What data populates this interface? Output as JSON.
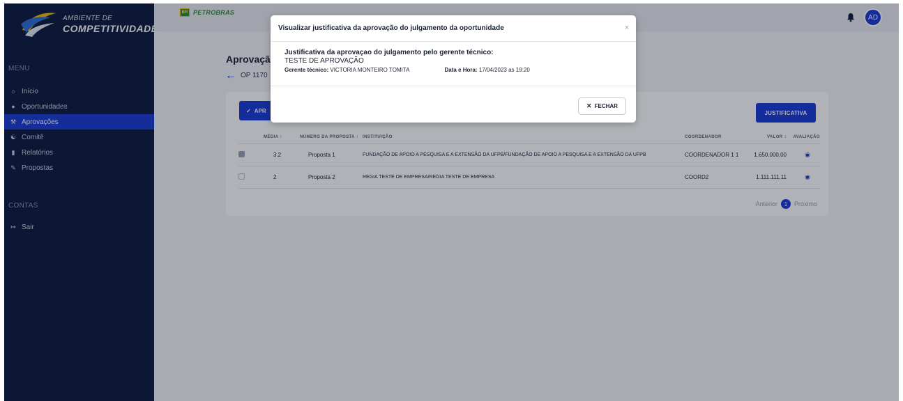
{
  "sidebar": {
    "logo_line1": "AMBIENTE DE",
    "logo_line2": "COMPETITIVIDADE",
    "menu_title": "MENU",
    "items": [
      {
        "label": "Início",
        "icon": "home-icon"
      },
      {
        "label": "Oportunidades",
        "icon": "lightbulb-icon"
      },
      {
        "label": "Aprovações",
        "icon": "gavel-icon",
        "active": true
      },
      {
        "label": "Comitê",
        "icon": "group-icon"
      },
      {
        "label": "Relatórios",
        "icon": "report-icon"
      },
      {
        "label": "Propostas",
        "icon": "proposal-icon"
      }
    ],
    "contas_title": "CONTAS",
    "sair_label": "Sair"
  },
  "topbar": {
    "brand_box": "BR",
    "brand": "PETROBRAS",
    "avatar_initials": "AD"
  },
  "main": {
    "title": "Aprovaçã",
    "op_code": "OP 1170",
    "aprovar_label": "APR",
    "justificativa_label": "JUSTIFICATIVA",
    "table": {
      "headers": [
        "MÉDIA",
        "NÚMERO DA PROPOSTA",
        "INSTITUIÇÃO",
        "COORDENADOR",
        "VALOR",
        "AVALIAÇÃO"
      ],
      "rows": [
        {
          "checked": true,
          "media": "3.2",
          "numero": "Proposta 1",
          "instituicao": "FUNDAÇÃO DE APOIO A PESQUISA E A EXTENSÃO DA UFPB/FUNDAÇÃO DE APOIO A PESQUISA E A EXTENSÃO DA UFPB",
          "coordenador": "COORDENADOR 1 1",
          "valor": "1.650.000,00"
        },
        {
          "checked": false,
          "media": "2",
          "numero": "Proposta 2",
          "instituicao": "REGIA TESTE DE EMPRESA/REGIA TESTE DE EMPRESA",
          "coordenador": "COORD2",
          "valor": "1.111.111,11"
        }
      ]
    },
    "pager": {
      "prev": "Anterior",
      "page": "1",
      "next": "Próximo"
    }
  },
  "modal": {
    "title": "Visualizar justificativa da aprovação do julgamento da oportunidade",
    "close_symbol": "×",
    "heading": "Justificativa da aprovaçao do julgamento pelo gerente técnico:",
    "text": "TESTE DE APROVAÇÃO",
    "manager_label": "Gerente técnico:",
    "manager_value": "VICTORIA MONTEIRO TOMITA",
    "date_label": "Data e Hora:",
    "date_value": "17/04/2023",
    "time_sep": "as",
    "time_value": "19:20",
    "fechar_label": "FECHAR"
  },
  "colors": {
    "sidebar": "#0d1b3e",
    "accent": "#1a3bd6",
    "brand_green": "#2d8c3c"
  }
}
